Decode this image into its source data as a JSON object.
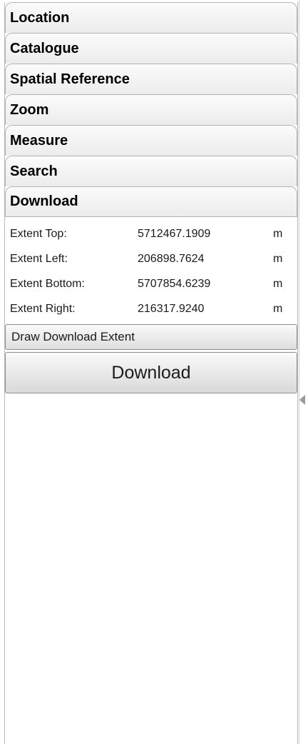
{
  "accordion": {
    "sections": [
      {
        "label": "Location"
      },
      {
        "label": "Catalogue"
      },
      {
        "label": "Spatial Reference"
      },
      {
        "label": "Zoom"
      },
      {
        "label": "Measure"
      },
      {
        "label": "Search"
      },
      {
        "label": "Download"
      }
    ]
  },
  "download": {
    "extent": [
      {
        "label": "Extent Top:",
        "value": "5712467.1909",
        "unit": "m"
      },
      {
        "label": "Extent Left:",
        "value": "206898.7624",
        "unit": "m"
      },
      {
        "label": "Extent Bottom:",
        "value": "5707854.6239",
        "unit": "m"
      },
      {
        "label": "Extent Right:",
        "value": "216317.9240",
        "unit": "m"
      }
    ],
    "draw_button": "Draw Download Extent",
    "download_button": "Download"
  },
  "splitter": {
    "icon": "collapse-left-arrow-icon"
  },
  "colors": {
    "header_gradient_top": "#fbfbfb",
    "header_gradient_bottom": "#ececec",
    "border": "#b3b3b3"
  }
}
